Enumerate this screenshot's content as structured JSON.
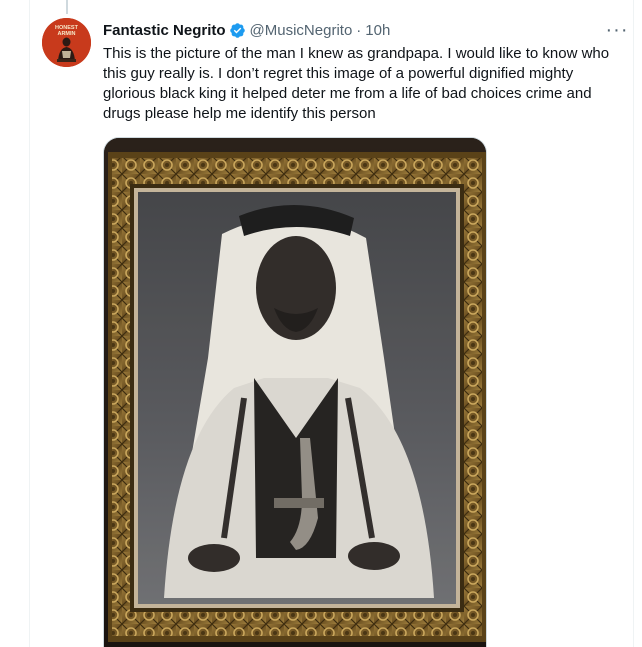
{
  "tweet": {
    "author_name": "Fantastic Negrito",
    "author_handle": "@MusicNegrito",
    "separator": "·",
    "time_ago": "10h",
    "more_label": "···",
    "text": "This is the picture of the man I knew as grandpapa. I would like to know who this guy really is. I don’t regret this image of a powerful dignified mighty glorious black king it helped deter me from a life of bad choices crime and drugs please help me identify this person"
  },
  "avatar": {
    "caption_line1": "HONEST",
    "caption_line2": "ARMIN"
  },
  "colors": {
    "name": "#0f1419",
    "secondary": "#536471",
    "verified": "#1d9bf0",
    "avatar_bg": "#c83a1c",
    "frame_gold": "#8a6a2e"
  },
  "icons": {
    "verified": "verified-badge-icon",
    "more": "more-dots-icon"
  }
}
